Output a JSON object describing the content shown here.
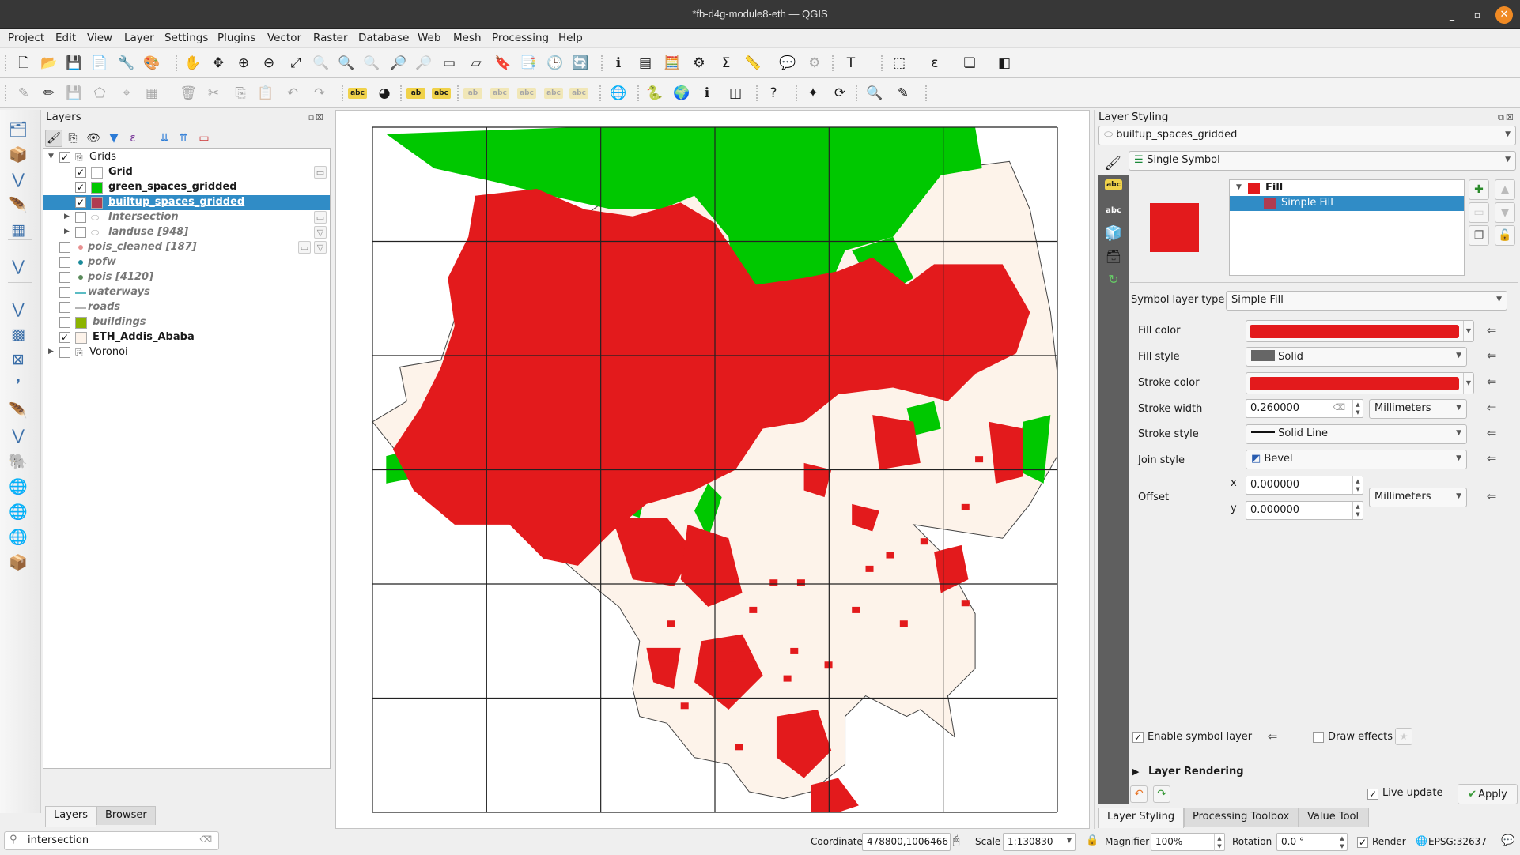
{
  "window": {
    "title": "*fb-d4g-module8-eth — QGIS",
    "controls": {
      "minimize": "_",
      "maximize": "▫",
      "close": "✕"
    }
  },
  "menu": [
    "Project",
    "Edit",
    "View",
    "Layer",
    "Settings",
    "Plugins",
    "Vector",
    "Raster",
    "Database",
    "Web",
    "Mesh",
    "Processing",
    "Help"
  ],
  "toolbar1": [
    {
      "name": "new-project-icon",
      "glyph": "🗋"
    },
    {
      "name": "open-project-icon",
      "glyph": "📂"
    },
    {
      "name": "save-project-icon",
      "glyph": "💾"
    },
    {
      "name": "new-print-layout-icon",
      "glyph": "📄"
    },
    {
      "name": "layout-manager-icon",
      "glyph": "🔧"
    },
    {
      "name": "style-manager-icon",
      "glyph": "🎨"
    },
    {
      "name": "pan-icon",
      "glyph": "✋"
    },
    {
      "name": "pan-to-selection-icon",
      "glyph": "✥"
    },
    {
      "name": "zoom-in-icon",
      "glyph": "⊕"
    },
    {
      "name": "zoom-out-icon",
      "glyph": "⊖"
    },
    {
      "name": "zoom-full-icon",
      "glyph": "⤢"
    },
    {
      "name": "zoom-selection-icon",
      "glyph": "🔍",
      "disabled": true
    },
    {
      "name": "zoom-layer-icon",
      "glyph": "🔍"
    },
    {
      "name": "zoom-native-icon",
      "glyph": "🔍",
      "disabled": true
    },
    {
      "name": "zoom-last-icon",
      "glyph": "🔎"
    },
    {
      "name": "zoom-next-icon",
      "glyph": "🔎",
      "disabled": true
    },
    {
      "name": "new-map-view-icon",
      "glyph": "▭"
    },
    {
      "name": "new-3d-map-view-icon",
      "glyph": "▱"
    },
    {
      "name": "new-bookmark-icon",
      "glyph": "🔖"
    },
    {
      "name": "show-bookmarks-icon",
      "glyph": "📑"
    },
    {
      "name": "temporal-controller-icon",
      "glyph": "🕒"
    },
    {
      "name": "refresh-icon",
      "glyph": "🔄"
    },
    {
      "name": "identify-icon",
      "glyph": "ℹ"
    },
    {
      "name": "attribute-table-icon",
      "glyph": "▤"
    },
    {
      "name": "field-calculator-icon",
      "glyph": "🧮"
    },
    {
      "name": "processing-toolbox-icon",
      "glyph": "⚙"
    },
    {
      "name": "statistical-summary-icon",
      "glyph": "Σ"
    },
    {
      "name": "measure-icon",
      "glyph": "📏"
    },
    {
      "name": "map-tips-icon",
      "glyph": "💬"
    },
    {
      "name": "run-action-icon",
      "glyph": "⚙",
      "disabled": true
    },
    {
      "name": "text-annotation-icon",
      "glyph": "T"
    },
    {
      "name": "select-features-icon",
      "glyph": "⬚"
    },
    {
      "name": "select-by-expression-icon",
      "glyph": "ε"
    },
    {
      "name": "deselect-all-icon",
      "glyph": "❏"
    },
    {
      "name": "select-by-location-icon",
      "glyph": "◧"
    }
  ],
  "toolbar2": [
    {
      "name": "current-edits-icon",
      "glyph": "✎",
      "disabled": true
    },
    {
      "name": "toggle-editing-icon",
      "glyph": "✏"
    },
    {
      "name": "save-edits-icon",
      "glyph": "💾",
      "disabled": true
    },
    {
      "name": "add-polygon-icon",
      "glyph": "⬠",
      "disabled": true
    },
    {
      "name": "vertex-tool-icon",
      "glyph": "⌖",
      "disabled": true
    },
    {
      "name": "modify-attributes-icon",
      "glyph": "▦",
      "disabled": true
    },
    {
      "name": "delete-selected-icon",
      "glyph": "🗑",
      "disabled": true
    },
    {
      "name": "cut-features-icon",
      "glyph": "✂",
      "disabled": true
    },
    {
      "name": "copy-features-icon",
      "glyph": "⎘",
      "disabled": true
    },
    {
      "name": "paste-features-icon",
      "glyph": "📋",
      "disabled": true
    },
    {
      "name": "undo-icon",
      "glyph": "↶",
      "disabled": true
    },
    {
      "name": "redo-icon",
      "glyph": "↷",
      "disabled": true
    },
    {
      "name": "label-toolbar-icon",
      "glyph": "abc"
    },
    {
      "name": "diagram-icon",
      "glyph": "◕"
    },
    {
      "name": "pin-labels-icon",
      "glyph": "ab"
    },
    {
      "name": "highlight-pinned-labels-icon",
      "glyph": "abc"
    },
    {
      "name": "move-label-icon",
      "glyph": "ab",
      "disabled": true
    },
    {
      "name": "show-hide-labels-icon",
      "glyph": "abc",
      "disabled": true
    },
    {
      "name": "move-label-2-icon",
      "glyph": "abc",
      "disabled": true
    },
    {
      "name": "rotate-label-icon",
      "glyph": "abc",
      "disabled": true
    },
    {
      "name": "change-label-icon",
      "glyph": "abc",
      "disabled": true
    },
    {
      "name": "web-browser-icon",
      "glyph": "🌐"
    },
    {
      "name": "python-console-icon",
      "glyph": "🐍"
    },
    {
      "name": "globe-icon",
      "glyph": "🌍"
    },
    {
      "name": "identify-plugin-icon",
      "glyph": "ℹ"
    },
    {
      "name": "map-swipe-icon",
      "glyph": "◫"
    },
    {
      "name": "help-icon",
      "glyph": "?"
    },
    {
      "name": "georeferencer-icon",
      "glyph": "✦"
    },
    {
      "name": "table-refresh-icon",
      "glyph": "⟳"
    },
    {
      "name": "locator-search-icon",
      "glyph": "🔍"
    },
    {
      "name": "map-tool-icon",
      "glyph": "✎"
    }
  ],
  "vtoolbar": [
    {
      "name": "data-source-manager-icon",
      "glyph": "🗂"
    },
    {
      "name": "new-geopackage-icon",
      "glyph": "📦"
    },
    {
      "name": "new-shapefile-icon",
      "glyph": "⋁"
    },
    {
      "name": "new-temp-scratch-icon",
      "glyph": "🪶"
    },
    {
      "name": "new-virtual-layer-icon",
      "glyph": "▦"
    },
    {
      "name": "new-spatialite-icon",
      "glyph": "⋁"
    },
    {
      "name": "add-vector-layer-icon",
      "glyph": "⋁"
    },
    {
      "name": "add-raster-layer-icon",
      "glyph": "▩"
    },
    {
      "name": "add-mesh-layer-icon",
      "glyph": "⊠"
    },
    {
      "name": "add-delimited-text-icon",
      "glyph": "❜"
    },
    {
      "name": "add-gpx-icon",
      "glyph": "🪶"
    },
    {
      "name": "add-spatialite-layer-icon",
      "glyph": "⋁"
    },
    {
      "name": "add-postgis-icon",
      "glyph": "🐘"
    },
    {
      "name": "add-wms-icon",
      "glyph": "🌐"
    },
    {
      "name": "add-wcs-icon",
      "glyph": "🌐"
    },
    {
      "name": "add-wfs-icon",
      "glyph": "🌐"
    },
    {
      "name": "add-virtual-layer-icon",
      "glyph": "📦"
    }
  ],
  "layers_panel": {
    "title": "Layers",
    "tabs": [
      "Layers",
      "Browser"
    ],
    "active_tab": "Layers",
    "items": [
      {
        "name": "Grids",
        "type": "group",
        "checked": true,
        "expanded": true,
        "indent": 0
      },
      {
        "name": "Grid",
        "type": "polygon",
        "checked": true,
        "swatch": "#ffffff",
        "bold": true,
        "indent": 1,
        "indicator": "memory"
      },
      {
        "name": "green_spaces_gridded",
        "type": "polygon",
        "checked": true,
        "swatch": "#00c800",
        "bold": true,
        "indent": 1
      },
      {
        "name": "builtup_spaces_gridded",
        "type": "polygon",
        "checked": true,
        "swatch": "#b03c50",
        "bold": true,
        "indent": 1,
        "selected": true
      },
      {
        "name": "Intersection",
        "type": "polygon-group",
        "checked": false,
        "italic": true,
        "indent": 1,
        "collapsed": true,
        "indicator": "memory"
      },
      {
        "name": "landuse [948]",
        "type": "polygon-group",
        "checked": false,
        "italic": true,
        "indent": 1,
        "collapsed": true,
        "indicator": "filter"
      },
      {
        "name": "pois_cleaned [187]",
        "type": "point",
        "checked": false,
        "italic": true,
        "indent": 0,
        "point_color": "#e89090",
        "indicator": "memory+filter"
      },
      {
        "name": "pofw",
        "type": "point",
        "checked": false,
        "italic": true,
        "indent": 0,
        "point_color": "#1a8a9a"
      },
      {
        "name": "pois [4120]",
        "type": "point",
        "checked": false,
        "italic": true,
        "indent": 0,
        "point_color": "#5a8a5a"
      },
      {
        "name": "waterways",
        "type": "line",
        "checked": false,
        "italic": true,
        "indent": 0,
        "line_color": "#5bbcc4"
      },
      {
        "name": "roads",
        "type": "line",
        "checked": false,
        "italic": true,
        "indent": 0,
        "line_color": "#b4b4b4"
      },
      {
        "name": "buildings",
        "type": "polygon",
        "checked": false,
        "italic": true,
        "indent": 0,
        "swatch": "#8cb400"
      },
      {
        "name": "ETH_Addis_Ababa",
        "type": "polygon",
        "checked": true,
        "bold": true,
        "indent": 0,
        "swatch": "#fdf3ea"
      },
      {
        "name": "Voronoi",
        "type": "group",
        "checked": false,
        "indent": 0,
        "collapsed": true
      }
    ]
  },
  "locator": {
    "value": "intersection"
  },
  "map": {
    "grid_cols": 6,
    "grid_rows": 6,
    "colors": {
      "boundary_fill": "#fdf3ea",
      "builtup": "#e31a1c",
      "green": "#00c800",
      "grid_line": "#222222"
    }
  },
  "styling_panel": {
    "title": "Layer Styling",
    "layer": "builtup_spaces_gridded",
    "renderer": "Single Symbol",
    "symbol_tree": {
      "root": "Fill",
      "child": "Simple Fill",
      "root_color": "#e31a1c",
      "child_color": "#b03c50"
    },
    "preview_color": "#e31a1c",
    "symbol_layer_type_label": "Symbol layer type",
    "symbol_layer_type": "Simple Fill",
    "fields": {
      "fill_color_label": "Fill color",
      "fill_color": "#e31a1c",
      "fill_style_label": "Fill style",
      "fill_style": "Solid",
      "stroke_color_label": "Stroke color",
      "stroke_color": "#e31a1c",
      "stroke_width_label": "Stroke width",
      "stroke_width": "0.260000",
      "stroke_width_unit": "Millimeters",
      "stroke_style_label": "Stroke style",
      "stroke_style": "Solid Line",
      "join_style_label": "Join style",
      "join_style": "Bevel",
      "offset_label": "Offset",
      "offset_x_label": "x",
      "offset_x": "0.000000",
      "offset_y_label": "y",
      "offset_y": "0.000000",
      "offset_unit": "Millimeters"
    },
    "enable_symbol_layer": {
      "label": "Enable symbol layer",
      "checked": true
    },
    "draw_effects": {
      "label": "Draw effects",
      "checked": false
    },
    "layer_rendering": "Layer Rendering",
    "live_update": {
      "label": "Live update",
      "checked": true
    },
    "apply": "Apply",
    "tabs": [
      "Layer Styling",
      "Processing Toolbox",
      "Value Tool"
    ],
    "active_tab": "Layer Styling"
  },
  "statusbar": {
    "coordinate_label": "Coordinate",
    "coordinate": "478800,1006466",
    "scale_label": "Scale",
    "scale": "1:130830",
    "magnifier_label": "Magnifier",
    "magnifier": "100%",
    "rotation_label": "Rotation",
    "rotation": "0.0 °",
    "render_label": "Render",
    "render_checked": true,
    "crs": "EPSG:32637"
  }
}
